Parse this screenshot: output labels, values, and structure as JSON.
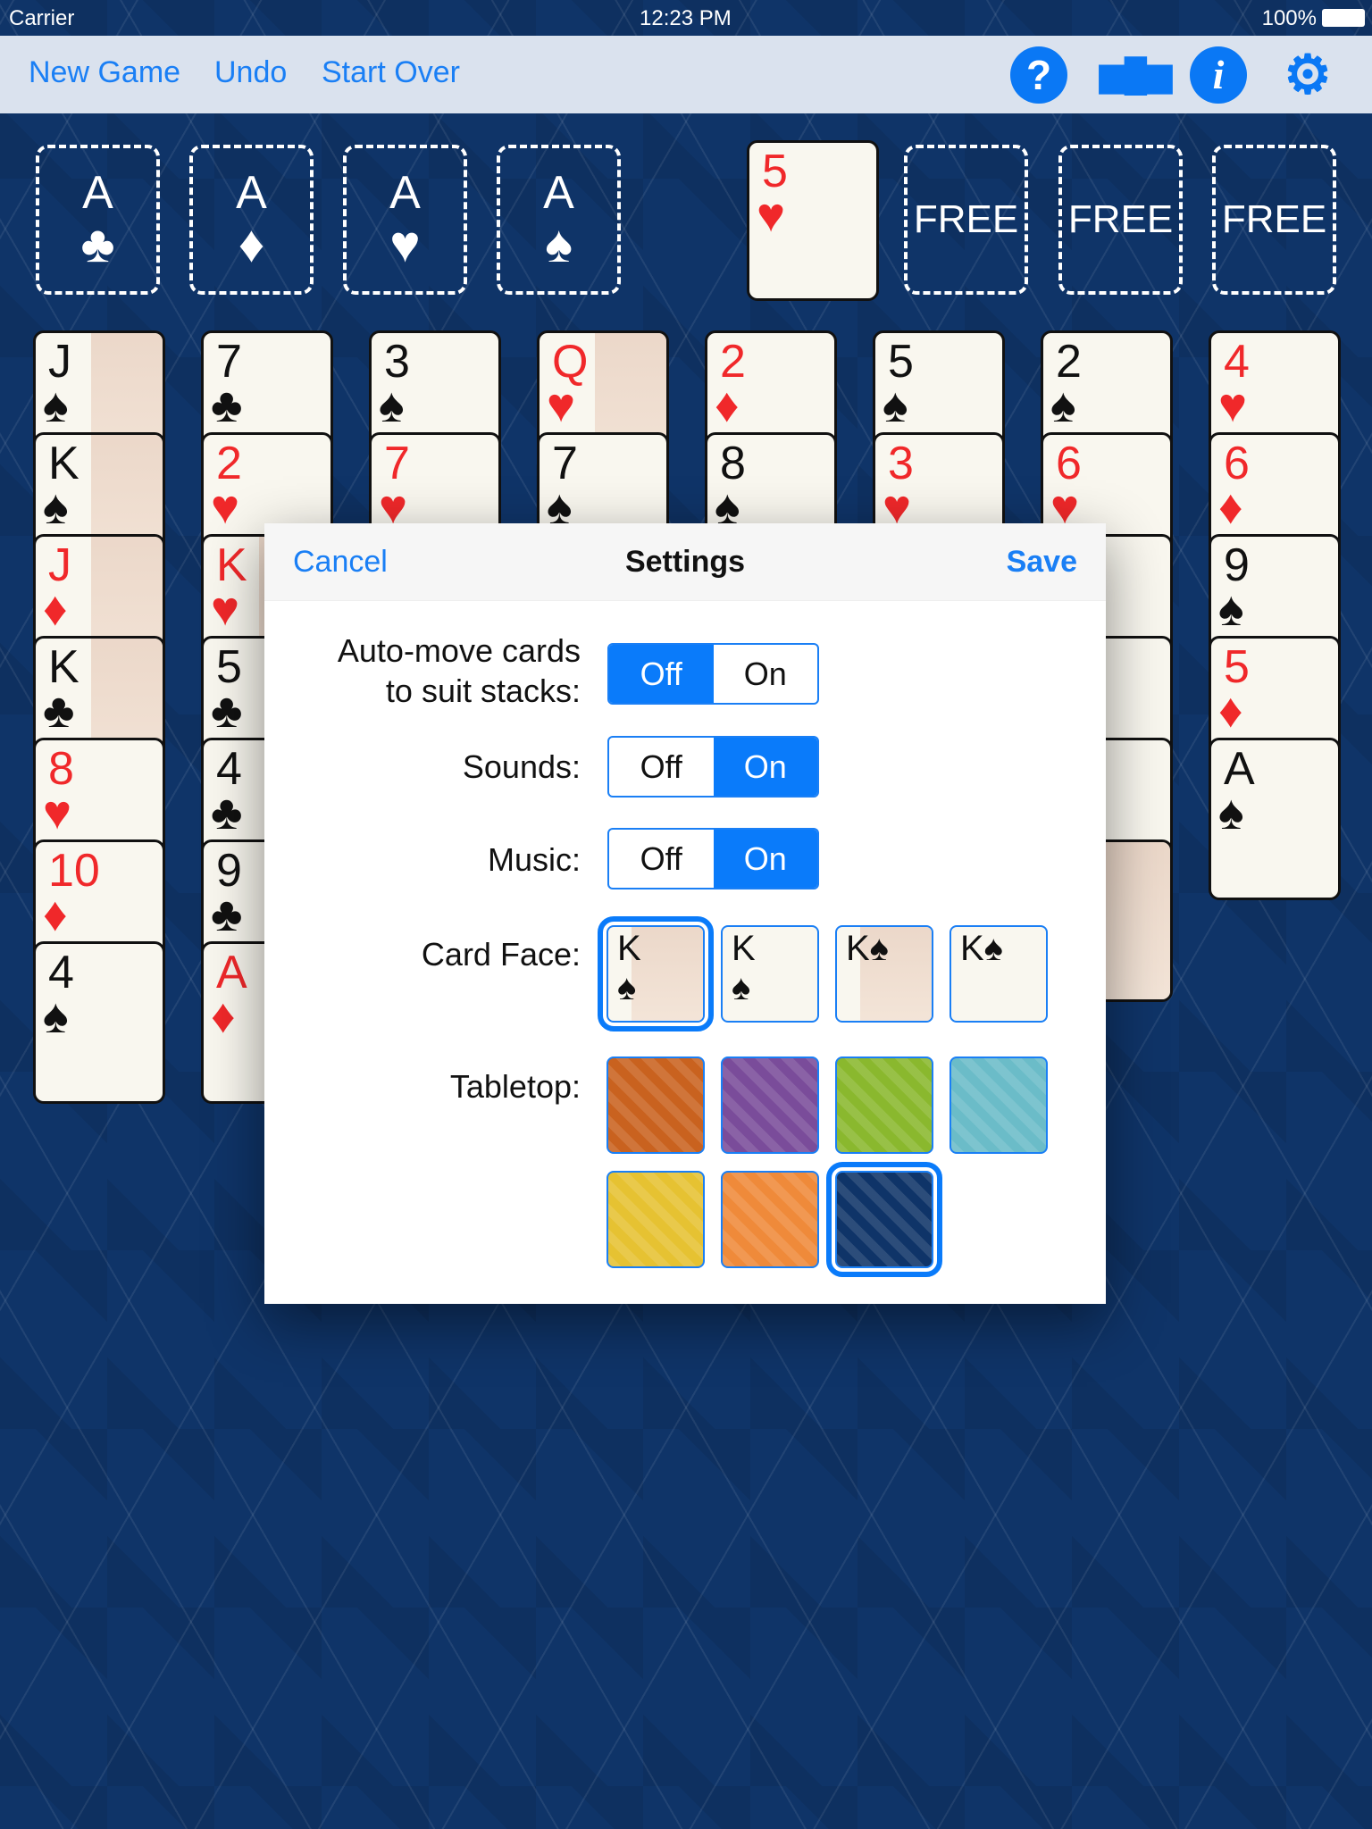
{
  "status": {
    "carrier": "Carrier",
    "time": "12:23 PM",
    "battery": "100%"
  },
  "toolbar": {
    "new_game": "New Game",
    "undo": "Undo",
    "start_over": "Start Over",
    "icons": [
      "help-icon",
      "leaderboard-icon",
      "info-icon",
      "gear-icon"
    ],
    "accent": "#0a78f5"
  },
  "foundations": [
    {
      "rank": "A",
      "suit": "♣"
    },
    {
      "rank": "A",
      "suit": "♦"
    },
    {
      "rank": "A",
      "suit": "♥"
    },
    {
      "rank": "A",
      "suit": "♠"
    }
  ],
  "freecells": [
    {
      "rank": "5",
      "suit": "♥"
    },
    {
      "label": "FREE"
    },
    {
      "label": "FREE"
    },
    {
      "label": "FREE"
    }
  ],
  "tableau": [
    [
      [
        "J",
        "♠",
        1
      ],
      [
        "K",
        "♠",
        1
      ],
      [
        "J",
        "♦",
        1
      ],
      [
        "K",
        "♣",
        1
      ],
      [
        "8",
        "♥",
        0
      ],
      [
        "10",
        "♦",
        0
      ],
      [
        "4",
        "♠",
        0
      ]
    ],
    [
      [
        "7",
        "♣",
        0
      ],
      [
        "2",
        "♥",
        0
      ],
      [
        "K",
        "♥",
        1
      ],
      [
        "5",
        "♣",
        0
      ],
      [
        "4",
        "♣",
        0
      ],
      [
        "9",
        "♣",
        0
      ],
      [
        "A",
        "♦",
        0
      ]
    ],
    [
      [
        "3",
        "♠",
        0
      ],
      [
        "7",
        "♥",
        0
      ]
    ],
    [
      [
        "Q",
        "♥",
        1
      ],
      [
        "7",
        "♠",
        0
      ]
    ],
    [
      [
        "2",
        "♦",
        0
      ],
      [
        "8",
        "♠",
        0
      ]
    ],
    [
      [
        "5",
        "♠",
        0
      ],
      [
        "3",
        "♥",
        0
      ]
    ],
    [
      [
        "2",
        "♠",
        0
      ],
      [
        "6",
        "♥",
        0
      ],
      [
        "",
        "",
        0
      ],
      [
        "",
        "",
        0
      ],
      [
        "",
        "",
        0
      ],
      [
        "",
        "",
        1
      ]
    ],
    [
      [
        "4",
        "♥",
        0
      ],
      [
        "6",
        "♦",
        0
      ],
      [
        "9",
        "♠",
        0
      ],
      [
        "5",
        "♦",
        0
      ],
      [
        "A",
        "♠",
        0
      ]
    ]
  ],
  "settings": {
    "cancel": "Cancel",
    "title": "Settings",
    "save": "Save",
    "automove": {
      "label1": "Auto-move cards",
      "label2": "to suit stacks:",
      "off": "Off",
      "on": "On",
      "value": "Off"
    },
    "sounds": {
      "label": "Sounds:",
      "off": "Off",
      "on": "On",
      "value": "On"
    },
    "music": {
      "label": "Music:",
      "off": "Off",
      "on": "On",
      "value": "On"
    },
    "card_face": {
      "label": "Card Face:",
      "options": [
        "K♠",
        "K♠",
        "K♠",
        "K♠"
      ],
      "selected": 0
    },
    "tabletop": {
      "label": "Tabletop:",
      "options": [
        "#c9621f",
        "#7a4c9a",
        "#8ab82e",
        "#6bbcc8",
        "#e6c232",
        "#ef8a3a",
        "#0f3468"
      ],
      "selected": 6
    }
  }
}
